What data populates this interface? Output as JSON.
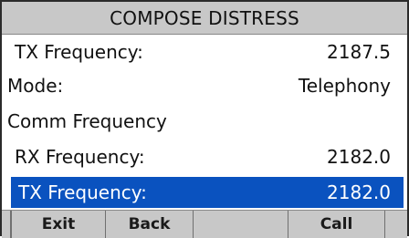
{
  "header": {
    "title": "COMPOSE DISTRESS"
  },
  "rows": [
    {
      "label": "TX Frequency:",
      "value": "2187.5"
    },
    {
      "label": "Mode:",
      "value": "Telephony"
    },
    {
      "label": "Comm Frequency",
      "value": ""
    },
    {
      "label": "RX Frequency:",
      "value": "2182.0"
    },
    {
      "label": "TX Frequency:",
      "value": "2182.0"
    }
  ],
  "softkeys": {
    "exit": "Exit",
    "back": "Back",
    "blank": "",
    "call": "Call"
  },
  "colors": {
    "title_bar": "#c8c8c8",
    "selection": "#0a52bf",
    "softkey_bar": "#c8c8c8"
  }
}
